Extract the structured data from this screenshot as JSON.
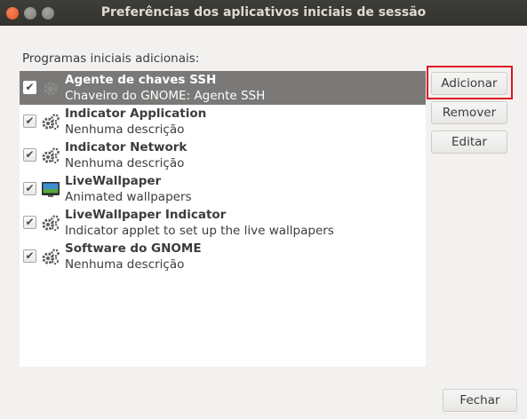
{
  "window": {
    "title": "Preferências dos aplicativos iniciais de sessão"
  },
  "section_label": "Programas iniciais adicionais:",
  "programs": [
    {
      "name": "Agente de chaves SSH",
      "description": "Chaveiro do GNOME: Agente SSH",
      "checked": true,
      "selected": true,
      "icon": "gear-icon"
    },
    {
      "name": "Indicator Application",
      "description": "Nenhuma descrição",
      "checked": true,
      "selected": false,
      "icon": "gear-icon"
    },
    {
      "name": "Indicator Network",
      "description": "Nenhuma descrição",
      "checked": true,
      "selected": false,
      "icon": "gear-icon"
    },
    {
      "name": "LiveWallpaper",
      "description": "Animated wallpapers",
      "checked": true,
      "selected": false,
      "icon": "wallpaper-icon"
    },
    {
      "name": "LiveWallpaper Indicator",
      "description": "Indicator applet to set up the live wallpapers",
      "checked": true,
      "selected": false,
      "icon": "gear-icon"
    },
    {
      "name": "Software do GNOME",
      "description": "Nenhuma descrição",
      "checked": true,
      "selected": false,
      "icon": "gear-icon"
    }
  ],
  "buttons": {
    "add": "Adicionar",
    "remove": "Remover",
    "edit": "Editar",
    "close": "Fechar"
  },
  "colors": {
    "selection": "#7a7977",
    "highlight_box": "#e0141e",
    "titlebar": "#3e3d39"
  }
}
